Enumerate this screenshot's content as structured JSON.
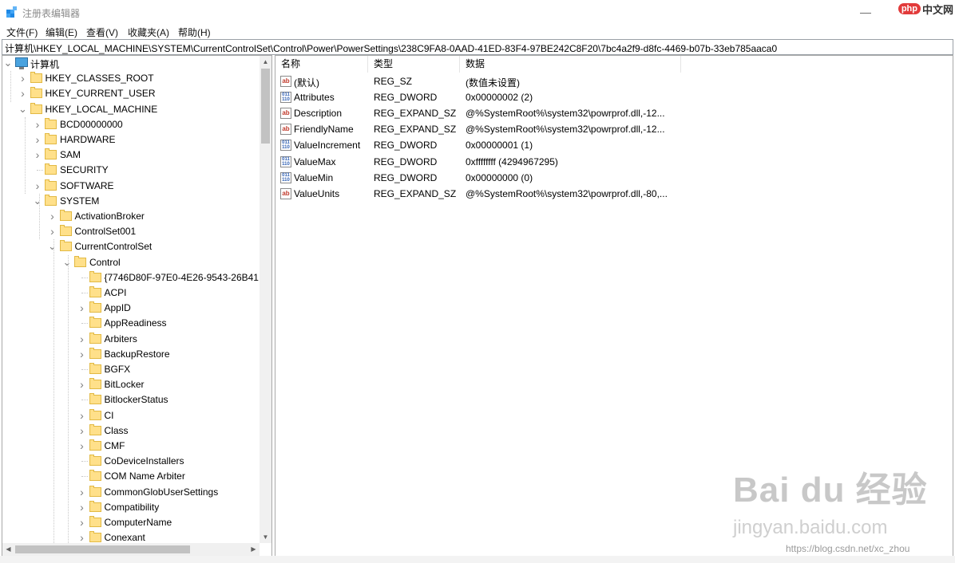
{
  "window": {
    "title": "注册表编辑器"
  },
  "watermarks": {
    "php_logo": "php",
    "php_site": "中文网",
    "baidu": "Bai du 经验",
    "baidu_url": "jingyan.baidu.com",
    "csdn": "https://blog.csdn.net/xc_zhou"
  },
  "menu": [
    "文件(F)",
    "编辑(E)",
    "查看(V)",
    "收藏夹(A)",
    "帮助(H)"
  ],
  "address": "计算机\\HKEY_LOCAL_MACHINE\\SYSTEM\\CurrentControlSet\\Control\\Power\\PowerSettings\\238C9FA8-0AAD-41ED-83F4-97BE242C8F20\\7bc4a2f9-d8fc-4469-b07b-33eb785aaca0",
  "tree": [
    {
      "label": "计算机",
      "icon": "computer-icon",
      "expander": "expanded"
    },
    {
      "label": "HKEY_CLASSES_ROOT",
      "icon": "folder-icon",
      "expander": "collapsed"
    },
    {
      "label": "HKEY_CURRENT_USER",
      "icon": "folder-icon",
      "expander": "collapsed"
    },
    {
      "label": "HKEY_LOCAL_MACHINE",
      "icon": "folder-icon",
      "expander": "expanded"
    },
    {
      "label": "BCD00000000",
      "icon": "folder-icon",
      "expander": "collapsed"
    },
    {
      "label": "HARDWARE",
      "icon": "folder-icon",
      "expander": "collapsed"
    },
    {
      "label": "SAM",
      "icon": "folder-icon",
      "expander": "collapsed"
    },
    {
      "label": "SECURITY",
      "icon": "folder-icon",
      "expander": "none"
    },
    {
      "label": "SOFTWARE",
      "icon": "folder-icon",
      "expander": "collapsed"
    },
    {
      "label": "SYSTEM",
      "icon": "folder-icon",
      "expander": "expanded"
    },
    {
      "label": "ActivationBroker",
      "icon": "folder-icon",
      "expander": "collapsed"
    },
    {
      "label": "ControlSet001",
      "icon": "folder-icon",
      "expander": "collapsed"
    },
    {
      "label": "CurrentControlSet",
      "icon": "folder-icon",
      "expander": "expanded"
    },
    {
      "label": "Control",
      "icon": "folder-icon",
      "expander": "expanded"
    },
    {
      "label": "{7746D80F-97E0-4E26-9543-26B41",
      "icon": "folder-icon",
      "expander": "none"
    },
    {
      "label": "ACPI",
      "icon": "folder-icon",
      "expander": "none"
    },
    {
      "label": "AppID",
      "icon": "folder-icon",
      "expander": "collapsed"
    },
    {
      "label": "AppReadiness",
      "icon": "folder-icon",
      "expander": "none"
    },
    {
      "label": "Arbiters",
      "icon": "folder-icon",
      "expander": "collapsed"
    },
    {
      "label": "BackupRestore",
      "icon": "folder-icon",
      "expander": "collapsed"
    },
    {
      "label": "BGFX",
      "icon": "folder-icon",
      "expander": "none"
    },
    {
      "label": "BitLocker",
      "icon": "folder-icon",
      "expander": "collapsed"
    },
    {
      "label": "BitlockerStatus",
      "icon": "folder-icon",
      "expander": "none"
    },
    {
      "label": "CI",
      "icon": "folder-icon",
      "expander": "collapsed"
    },
    {
      "label": "Class",
      "icon": "folder-icon",
      "expander": "collapsed"
    },
    {
      "label": "CMF",
      "icon": "folder-icon",
      "expander": "collapsed"
    },
    {
      "label": "CoDeviceInstallers",
      "icon": "folder-icon",
      "expander": "none"
    },
    {
      "label": "COM Name Arbiter",
      "icon": "folder-icon",
      "expander": "none"
    },
    {
      "label": "CommonGlobUserSettings",
      "icon": "folder-icon",
      "expander": "collapsed"
    },
    {
      "label": "Compatibility",
      "icon": "folder-icon",
      "expander": "collapsed"
    },
    {
      "label": "ComputerName",
      "icon": "folder-icon",
      "expander": "collapsed"
    },
    {
      "label": "Conexant",
      "icon": "folder-icon",
      "expander": "collapsed"
    }
  ],
  "list": {
    "columns": [
      "名称",
      "类型",
      "数据"
    ],
    "rows": [
      {
        "icon": "string-value-icon",
        "name": "(默认)",
        "type": "REG_SZ",
        "data": "(数值未设置)"
      },
      {
        "icon": "dword-value-icon",
        "name": "Attributes",
        "type": "REG_DWORD",
        "data": "0x00000002 (2)"
      },
      {
        "icon": "string-value-icon",
        "name": "Description",
        "type": "REG_EXPAND_SZ",
        "data": "@%SystemRoot%\\system32\\powrprof.dll,-12..."
      },
      {
        "icon": "string-value-icon",
        "name": "FriendlyName",
        "type": "REG_EXPAND_SZ",
        "data": "@%SystemRoot%\\system32\\powrprof.dll,-12..."
      },
      {
        "icon": "dword-value-icon",
        "name": "ValueIncrement",
        "type": "REG_DWORD",
        "data": "0x00000001 (1)"
      },
      {
        "icon": "dword-value-icon",
        "name": "ValueMax",
        "type": "REG_DWORD",
        "data": "0xffffffff (4294967295)"
      },
      {
        "icon": "dword-value-icon",
        "name": "ValueMin",
        "type": "REG_DWORD",
        "data": "0x00000000 (0)"
      },
      {
        "icon": "string-value-icon",
        "name": "ValueUnits",
        "type": "REG_EXPAND_SZ",
        "data": "@%SystemRoot%\\system32\\powrprof.dll,-80,..."
      }
    ]
  }
}
